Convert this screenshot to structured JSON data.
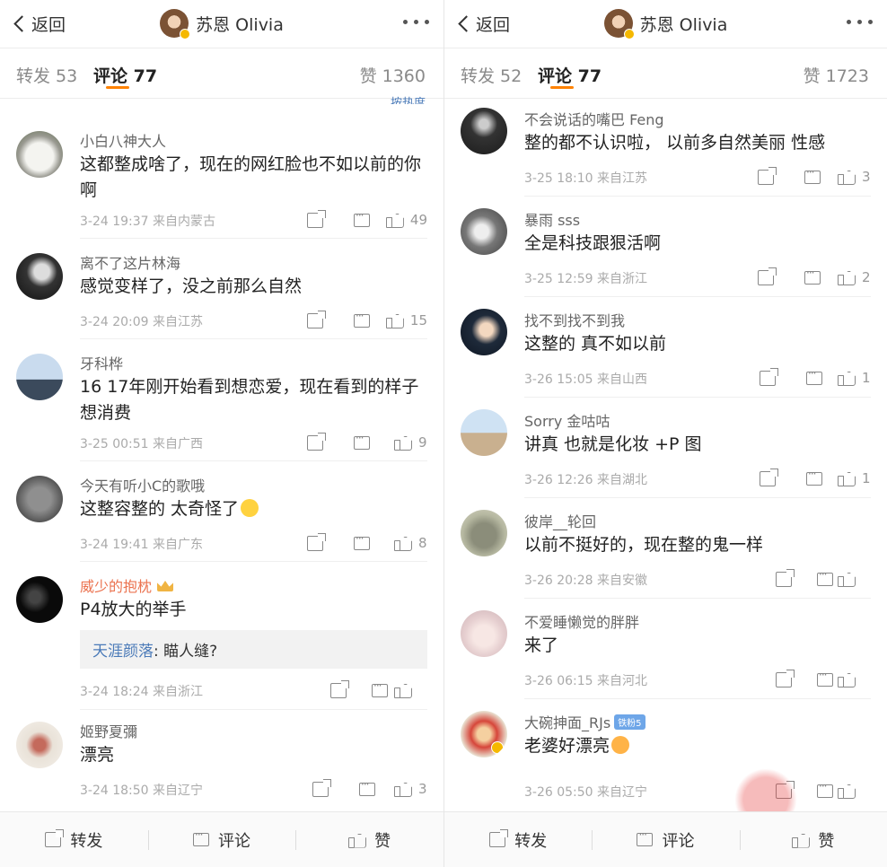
{
  "left": {
    "back_label": "返回",
    "title": "苏恩 Olivia",
    "tabs": {
      "repost": "转发 53",
      "comments": "评论 77",
      "likes": "赞 1360"
    },
    "sort_label": "按热度",
    "comments": [
      {
        "name": "小白八神大人",
        "text": "这都整成啥了，现在的网红脸也不如以前的你啊",
        "meta": "3-24 19:37 来自内蒙古",
        "likes": "49"
      },
      {
        "name": "离不了这片林海",
        "text": "感觉变样了，没之前那么自然",
        "meta": "3-24 20:09 来自江苏",
        "likes": "15"
      },
      {
        "name": "牙科桦",
        "text": "16 17年刚开始看到想恋爱，现在看到的样子想消费",
        "meta": "3-25 00:51 来自广西",
        "likes": "9"
      },
      {
        "name": "今天有听小C的歌哦",
        "text": "这整容整的 太奇怪了",
        "meta": "3-24 19:41 来自广东",
        "likes": "8"
      },
      {
        "name": "威少的抱枕",
        "text": "P4放大的举手",
        "reply_name": "天涯颜落",
        "reply_text": ": 瞄人缝?",
        "meta": "3-24 18:24 来自浙江",
        "likes": ""
      },
      {
        "name": "姬野夏彌",
        "text": "漂亮",
        "meta": "3-24 18:50 来自辽宁",
        "likes": "3"
      }
    ],
    "bottom": {
      "repost": "转发",
      "comment": "评论",
      "like": "赞"
    }
  },
  "right": {
    "back_label": "返回",
    "title": "苏恩 Olivia",
    "tabs": {
      "repost": "转发 52",
      "comments": "评论 77",
      "likes": "赞 1723"
    },
    "comments": [
      {
        "name": "不会说话的嘴巴 Feng",
        "text": "整的都不认识啦， 以前多自然美丽 性感",
        "meta": "3-25 18:10 来自江苏",
        "likes": "3"
      },
      {
        "name": "暴雨 sss",
        "text": "全是科技跟狠活啊",
        "meta": "3-25 12:59 来自浙江",
        "likes": "2"
      },
      {
        "name": "找不到找不到我",
        "text": "这整的 真不如以前",
        "meta": "3-26 15:05 来自山西",
        "likes": "1"
      },
      {
        "name": "Sorry 金咕咕",
        "text": "讲真 也就是化妆 +P 图",
        "meta": "3-26 12:26 来自湖北",
        "likes": "1"
      },
      {
        "name": "彼岸__轮回",
        "text": "以前不挺好的，现在整的鬼一样",
        "meta": "3-26 20:28 来自安徽",
        "likes": ""
      },
      {
        "name": "不爱睡懒觉的胖胖",
        "text": "来了",
        "meta": "3-26 06:15 来自河北",
        "likes": ""
      },
      {
        "name": "大碗抻面_RJs",
        "badge": "铁粉5",
        "text": "老婆好漂亮",
        "meta": "3-26 05:50 来自辽宁",
        "likes": ""
      }
    ],
    "bottom": {
      "repost": "转发",
      "comment": "评论",
      "like": "赞"
    }
  },
  "icons": [
    "back-chevron-icon",
    "more-icon",
    "share-icon",
    "comment-icon",
    "like-icon"
  ]
}
